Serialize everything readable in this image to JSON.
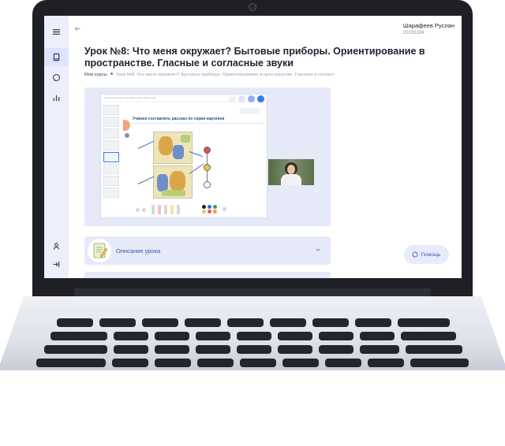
{
  "user": {
    "name": "Шарафеев Руслан",
    "id": "20193184"
  },
  "page": {
    "title": "Урок №8: Что меня окружает? Бытовые приборы. Ориентирование в пространстве. Гласные и согласные звуки"
  },
  "breadcrumb": {
    "root": "Мои курсы",
    "current": "Урок №8: Что меня окружает? Бытовые приборы. Ориентирование в пространстве. Гласные и согласт"
  },
  "video": {
    "slide_topbar_text": "Презентация урока. Подготовка к школе. Занятие №8",
    "slide_heading": "Учимся составлять рассказ по серии картинок"
  },
  "description": {
    "label": "Описание урока"
  },
  "help": {
    "label": "Помощь"
  },
  "sidebar": {
    "items": [
      {
        "name": "menu-icon"
      },
      {
        "name": "book-icon"
      },
      {
        "name": "chat-icon"
      },
      {
        "name": "stats-icon"
      },
      {
        "name": "profile-icon"
      },
      {
        "name": "logout-icon"
      }
    ]
  },
  "colors": {
    "accent": "#3a57b4",
    "sidebar_bg": "#eceefb",
    "card_bg": "#e6e9f8",
    "laptop_body": "#1f1f26"
  }
}
